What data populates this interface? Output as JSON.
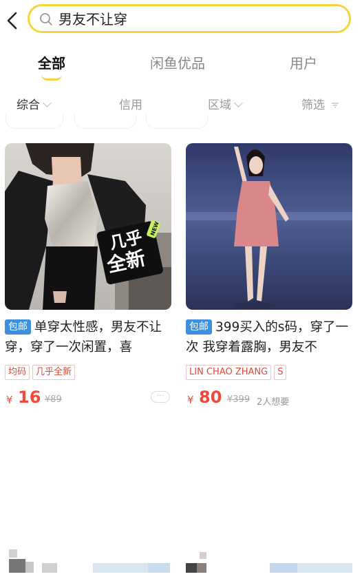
{
  "search": {
    "query": "男友不让穿"
  },
  "tabs": [
    {
      "label": "全部",
      "active": true
    },
    {
      "label": "闲鱼优品",
      "active": false
    },
    {
      "label": "用户",
      "active": false
    }
  ],
  "filters": [
    {
      "label": "综合",
      "active": true,
      "icon": "chevron-down-icon"
    },
    {
      "label": "信用",
      "active": false
    },
    {
      "label": "区域",
      "active": false,
      "icon": "chevron-down-icon"
    },
    {
      "label": "筛选",
      "active": false,
      "icon": "filter-icon"
    }
  ],
  "products": [
    {
      "badge": "包邮",
      "title": "单穿太性感，男友不让穿，穿了一次闲置，喜",
      "overlay_text": [
        "几乎",
        "全新"
      ],
      "overlay_tag": "NEW",
      "tags": [
        "均码",
        "几乎全新"
      ],
      "currency": "¥",
      "price": "16",
      "old_price": "¥89",
      "want": "",
      "more": "···"
    },
    {
      "badge": "包邮",
      "title": "399买入的s码，穿了一次 我穿着露胸，男友不",
      "overlay_text": [],
      "overlay_tag": "",
      "tags": [
        "LIN CHAO ZHANG",
        "S"
      ],
      "currency": "¥",
      "price": "80",
      "old_price": "¥399",
      "want": "2人想要",
      "more": ""
    }
  ],
  "colors": {
    "accent": "#f5d53e",
    "price": "#f04a3c",
    "badge": "#3f8fdf",
    "tag_border": "#f1c4c4"
  }
}
